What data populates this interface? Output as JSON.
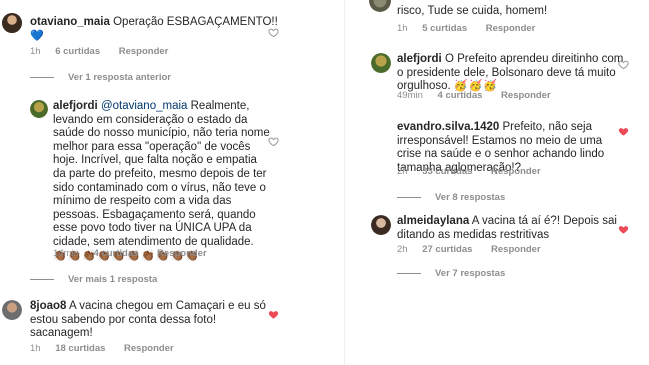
{
  "left": {
    "c1": {
      "username": "otaviano_maia",
      "text": "Operação ESBAGAÇAMENTO!!",
      "emoji": "💙",
      "time": "1h",
      "likes": "6 curtidas",
      "reply": "Responder"
    },
    "more_previous": "Ver 1 resposta anterior",
    "c2": {
      "username": "alefjordi",
      "mention": "@otaviano_maia",
      "text": "Realmente, levando em consideração o estado da saúde do nosso município, não teria nome melhor para essa \"operação\" de vocês hoje. Incrível, que falta noção e empatia da parte do prefeito, mesmo depois de ter sido contaminado com o vírus, não teve o mínimo de respeito com a vida das pessoas. Esbagaçamento será, quando esse povo todo tiver na ÚNICA UPA da cidade, sem atendimento de qualidade.",
      "emoji": "👏🏾👏🏾👏🏾👏🏾👏🏾👏🏾👏🏾👏🏾👏🏾👏🏾",
      "time": "14min",
      "likes": "4 curtidas",
      "reply": "Responder"
    },
    "more_replies": "Ver mais 1 resposta",
    "c3": {
      "username": "8joao8",
      "text": "A vacina chegou em Camaçari e eu só estou sabendo por conta dessa foto! sacanagem!",
      "time": "1h",
      "likes": "18 curtidas",
      "reply": "Responder"
    }
  },
  "right": {
    "c0": {
      "text": "risco, Tude se cuida, homem!",
      "time": "1h",
      "likes": "5 curtidas",
      "reply": "Responder"
    },
    "c1": {
      "username": "alefjordi",
      "text": "O Prefeito aprendeu direitinho com o presidente dele, Bolsonaro deve tá muito orgulhoso.",
      "emoji": "🥳🥳🥳",
      "time": "49min",
      "likes": "4 curtidas",
      "reply": "Responder"
    },
    "c2": {
      "username": "evandro.silva.1420",
      "text": "Prefeito, não seja irresponsável! Estamos no meio de uma crise na saúde e o senhor achando lindo tamanha aglomeração!?",
      "time": "2h",
      "likes": "33 curtidas",
      "reply": "Responder",
      "more": "Ver 8 respostas"
    },
    "c3": {
      "username": "almeidaylana",
      "text": "A vacina tá aí é?! Depois sai ditando as medidas restritivas",
      "time": "2h",
      "likes": "27 curtidas",
      "reply": "Responder",
      "more": "Ver 7 respostas"
    }
  },
  "colors": {
    "heart_liked": "#ed4956",
    "heart_empty": "#8e8e8e",
    "meta": "#8e8e8e",
    "mention": "#00376b"
  }
}
